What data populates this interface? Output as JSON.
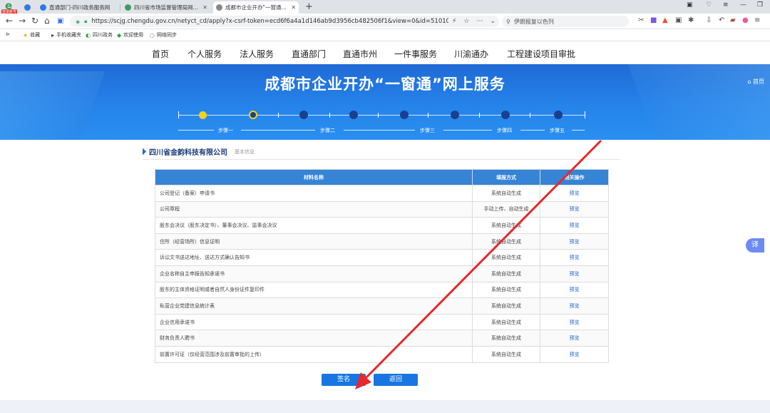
{
  "browser": {
    "badge": "登录账号",
    "tabs": [
      {
        "title": "直通部门-四川政务服务网",
        "active": false,
        "color": "#2b7be3"
      },
      {
        "title": "四川省市场监督管理局网上办...",
        "active": false,
        "color": "#3a9e5c"
      },
      {
        "title": "成都市企业开办\"一窗通\"网上服...",
        "active": true,
        "color": "#888888"
      }
    ],
    "url": "https://scjg.chengdu.gov.cn/netyct_cd/apply?x-csrf-token=ecd6f6a4a1d146ab9d3956cb482506f1&view=0&id=510109Y3202506059",
    "search_text": "伊朗报复以色列",
    "favorites": [
      "收藏",
      "手机收藏夹",
      "四川政务",
      "欢迎使用",
      "网络同步"
    ]
  },
  "site_nav": [
    "首页",
    "个人服务",
    "法人服务",
    "直通部门",
    "直通市州",
    "一件事服务",
    "川渝通办",
    "工程建设项目审批"
  ],
  "banner": {
    "title": "成都市企业开办“一窗通”网上服务",
    "home_label": "首页"
  },
  "steps": [
    "步骤一",
    "步骤二",
    "步骤三",
    "步骤四",
    "步骤五"
  ],
  "company": {
    "name": "四川省金韵科技有限公司",
    "sub": "基本信息"
  },
  "table": {
    "headers": [
      "材料名称",
      "填报方式",
      "相关操作"
    ],
    "rows": [
      {
        "name": "公司登记（备案）申请书",
        "method": "系统自动生成",
        "action": "预览"
      },
      {
        "name": "公司章程",
        "method": "手动上传、自动生成",
        "action": "预览"
      },
      {
        "name": "股东会决议（股东决定书）、董事会决议、监事会决议",
        "method": "系统自动生成",
        "action": "预览"
      },
      {
        "name": "住所（经营场所）信息证明",
        "method": "系统自动生成",
        "action": "预览"
      },
      {
        "name": "诉讼文书送达地址、送达方式确认告知书",
        "method": "系统自动生成",
        "action": "预览"
      },
      {
        "name": "企业名称自主申报告知承诺书",
        "method": "系统自动生成",
        "action": "预览"
      },
      {
        "name": "股东的主体资格证明或者自然人身份证件复印件",
        "method": "系统自动生成",
        "action": "预览"
      },
      {
        "name": "私营企业党建信息统计表",
        "method": "系统自动生成",
        "action": "预览"
      },
      {
        "name": "企业信用承诺书",
        "method": "系统自动生成",
        "action": "预览"
      },
      {
        "name": "财务负责人聘书",
        "method": "系统自动生成",
        "action": "预览"
      },
      {
        "name": "前置许可证（仅经营范围涉及前置审批的上传）",
        "method": "系统自动生成",
        "action": "预览"
      }
    ]
  },
  "buttons": {
    "sign": "签名",
    "back": "返回"
  },
  "float_button": "译",
  "colors": {
    "banner": "#2583ea",
    "table_header": "#3584d5",
    "button": "#1776e2",
    "annotation_arrow": "#e8282b"
  }
}
